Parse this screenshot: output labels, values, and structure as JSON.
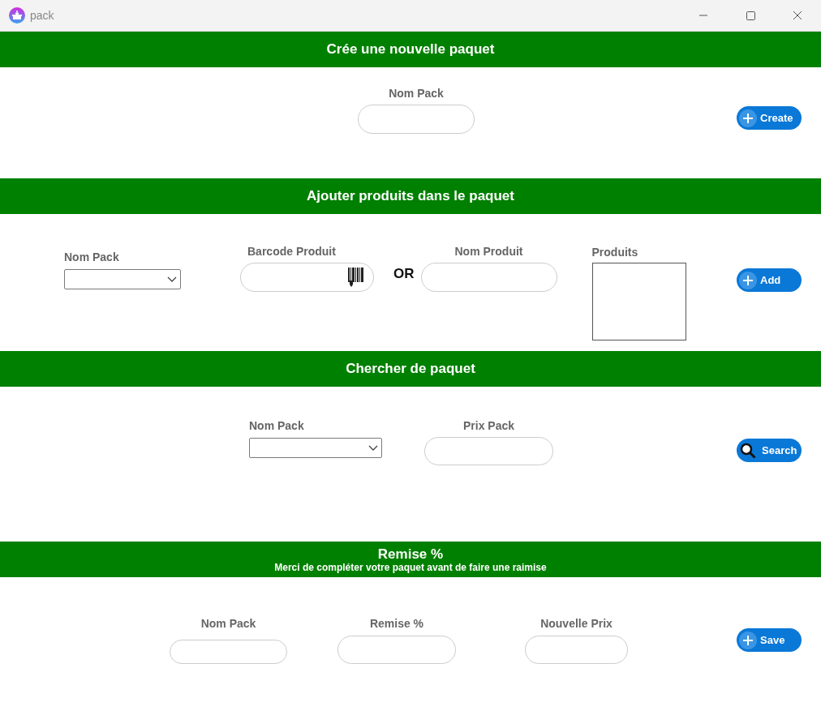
{
  "window": {
    "title": "pack"
  },
  "sections": [
    {
      "title": "Crée une nouvelle paquet",
      "fields": [
        {
          "kind": "input",
          "label": "Nom Pack"
        }
      ],
      "button": {
        "label": "Create",
        "kind": "add"
      }
    },
    {
      "title": "Ajouter produits dans le paquet",
      "fields": [
        {
          "kind": "select",
          "label": "Nom Pack"
        },
        {
          "kind": "barcode",
          "label": "Barcode Produit"
        },
        {
          "kind": "separator",
          "text": "OR"
        },
        {
          "kind": "input",
          "label": "Nom Produit"
        },
        {
          "kind": "listbox",
          "label": "Produits"
        }
      ],
      "button": {
        "label": "Add",
        "kind": "add"
      }
    },
    {
      "title": "Chercher de paquet",
      "fields": [
        {
          "kind": "select",
          "label": "Nom Pack"
        },
        {
          "kind": "input",
          "label": "Prix Pack"
        }
      ],
      "button": {
        "label": "Search",
        "kind": "search"
      }
    },
    {
      "title": "Remise %",
      "subtitle": "Merci de compléter votre paquet avant de faire une raimise",
      "fields": [
        {
          "kind": "input",
          "label": "Nom Pack"
        },
        {
          "kind": "input",
          "label": "Remise %"
        },
        {
          "kind": "input",
          "label": "Nouvelle Prix"
        }
      ],
      "button": {
        "label": "Save",
        "kind": "add"
      }
    }
  ]
}
